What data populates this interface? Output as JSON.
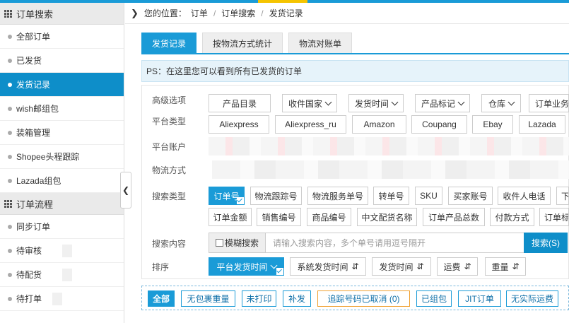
{
  "colors": {
    "accent": "#1a9bd7",
    "active_nav": "#0e8ec9",
    "highlight_bar": "#f5c400"
  },
  "sidebar": {
    "order_search": {
      "title": "订单搜索",
      "items": [
        "全部订单",
        "已发货",
        "发货记录",
        "wish邮组包",
        "装箱管理",
        "Shopee头程跟踪",
        "Lazada组包"
      ],
      "active": "发货记录"
    },
    "order_flow": {
      "title": "订单流程",
      "items": [
        "同步订单",
        "待审核",
        "待配货",
        "待打单"
      ]
    }
  },
  "breadcrumb": {
    "prefix": "您的位置：",
    "items": [
      "订单",
      "订单搜索",
      "发货记录"
    ]
  },
  "tabs": [
    {
      "label": "发货记录",
      "active": true
    },
    {
      "label": "按物流方式统计",
      "active": false
    },
    {
      "label": "物流对账单",
      "active": false
    }
  ],
  "ps_text": "PS：在这里您可以看到所有已发货的订单",
  "advanced": {
    "label": "高级选项",
    "options": [
      "产品目录",
      "收件国家",
      "发货时间",
      "产品标记",
      "仓库",
      "订单业务"
    ]
  },
  "platform": {
    "label": "平台类型",
    "options": [
      "Aliexpress",
      "Aliexpress_ru",
      "Amazon",
      "Coupang",
      "Ebay",
      "Lazada"
    ]
  },
  "account_label": "平台账户",
  "logistics_label": "物流方式",
  "search_type": {
    "label": "搜索类型",
    "row1": [
      "订单号",
      "物流跟踪号",
      "物流服务单号",
      "转单号",
      "SKU",
      "买家账号",
      "收件人电话",
      "下"
    ],
    "row2": [
      "订单金额",
      "销售编号",
      "商品编号",
      "中文配货名称",
      "订单产品总数",
      "付款方式",
      "订单标"
    ],
    "selected": "订单号"
  },
  "search": {
    "label": "搜索内容",
    "fuzzy_label": "模糊搜索",
    "placeholder": "请输入搜索内容，多个单号请用逗号隔开",
    "button": "搜索(S)"
  },
  "sort": {
    "label": "排序",
    "options": [
      "平台发货时间",
      "系统发货时间",
      "发货时间",
      "运费",
      "重量"
    ],
    "selected": "平台发货时间"
  },
  "filters": [
    "全部",
    "无包裹重量",
    "未打印",
    "补发",
    "追踪号码已取消 (0)",
    "已组包",
    "JIT订单",
    "无实际运费"
  ],
  "icons": {
    "grid": "grid-icon",
    "collapse": "chevron-left-icon",
    "breadcrumb": "chevron-right-icon",
    "caret": "caret-down-icon",
    "sort": "sort-arrows-icon"
  }
}
